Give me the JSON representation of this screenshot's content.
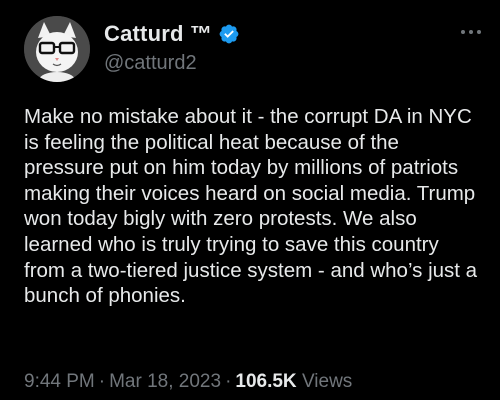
{
  "user": {
    "display_name": "Catturd ™",
    "handle": "@catturd2",
    "avatar_icon": "cat-with-glasses-avatar",
    "verified_icon": "verified-badge-icon",
    "verified_color": "#1d9bf0"
  },
  "tweet": {
    "text": "Make no mistake about it - the corrupt DA in NYC is feeling the political heat because of the pressure put on him today by millions of patriots making their voices heard on social media. Trump won today bigly with zero protests. We also learned who is truly trying to save this country from a two-tiered justice system - and who’s just a bunch of phonies."
  },
  "meta": {
    "time": "9:44 PM",
    "separator": "·",
    "date": "Mar 18, 2023",
    "views_count": "106.5K",
    "views_label": "Views"
  },
  "actions": {
    "more_icon": "more-options-icon"
  },
  "colors": {
    "background": "#000000",
    "primary_text": "#e7e9ea",
    "secondary_text": "#71767b"
  }
}
